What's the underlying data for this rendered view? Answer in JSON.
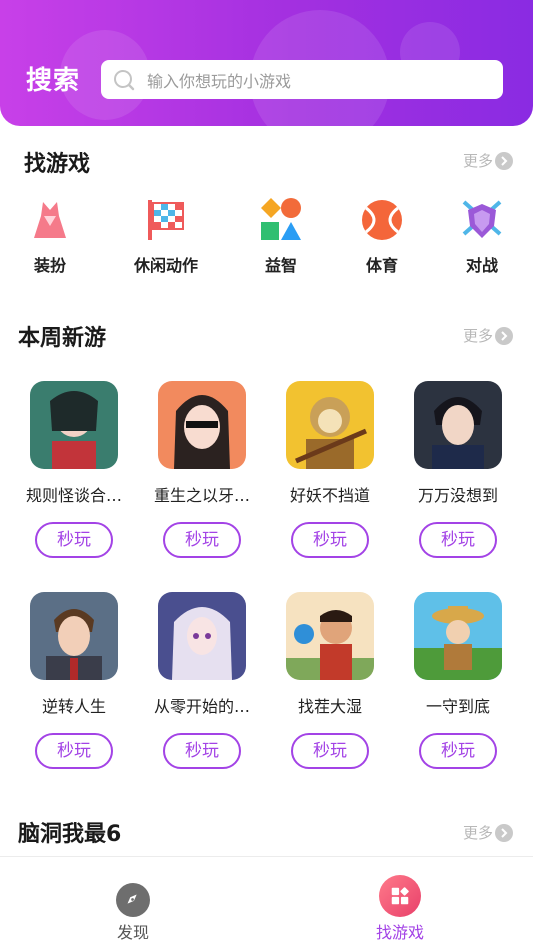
{
  "header": {
    "title": "搜索",
    "search_placeholder": "输入你想玩的小游戏"
  },
  "find_games": {
    "title": "找游戏",
    "more_label": "更多",
    "categories": [
      {
        "label": "装扮",
        "icon": "dress-icon"
      },
      {
        "label": "休闲动作",
        "icon": "checkered-flag-icon"
      },
      {
        "label": "益智",
        "icon": "shapes-icon"
      },
      {
        "label": "体育",
        "icon": "ball-icon"
      },
      {
        "label": "对战",
        "icon": "shield-icon"
      }
    ]
  },
  "new_this_week": {
    "title": "本周新游",
    "more_label": "更多",
    "play_label": "秒玩",
    "games": [
      {
        "name": "规则怪谈合…",
        "colors": [
          "#3a7d6e",
          "#c2343a"
        ]
      },
      {
        "name": "重生之以牙…",
        "colors": [
          "#f28a5e",
          "#2b2220"
        ]
      },
      {
        "name": "好妖不挡道",
        "colors": [
          "#f2c230",
          "#9a6a2a"
        ]
      },
      {
        "name": "万万没想到",
        "colors": [
          "#2c3340",
          "#1e2a4a"
        ]
      },
      {
        "name": "逆转人生",
        "colors": [
          "#5b6f86",
          "#3a3d4a"
        ]
      },
      {
        "name": "从零开始的…",
        "colors": [
          "#4a4f8f",
          "#e6e0f0"
        ]
      },
      {
        "name": "找茬大湿",
        "colors": [
          "#f6e2c0",
          "#c23a2a"
        ]
      },
      {
        "name": "一守到底",
        "colors": [
          "#5fc0e8",
          "#4e9b3a"
        ]
      }
    ]
  },
  "brain_section": {
    "title": "脑洞我最6",
    "more_label": "更多"
  },
  "tabbar": {
    "items": [
      {
        "label": "发现",
        "icon": "compass-icon",
        "active": false
      },
      {
        "label": "找游戏",
        "icon": "apps-icon",
        "active": true
      }
    ]
  },
  "colors": {
    "accent": "#a343e6",
    "header_start": "#c840e8",
    "header_end": "#8a2be2",
    "tab_active": "#a343e6",
    "tab_inactive": "#555555"
  }
}
